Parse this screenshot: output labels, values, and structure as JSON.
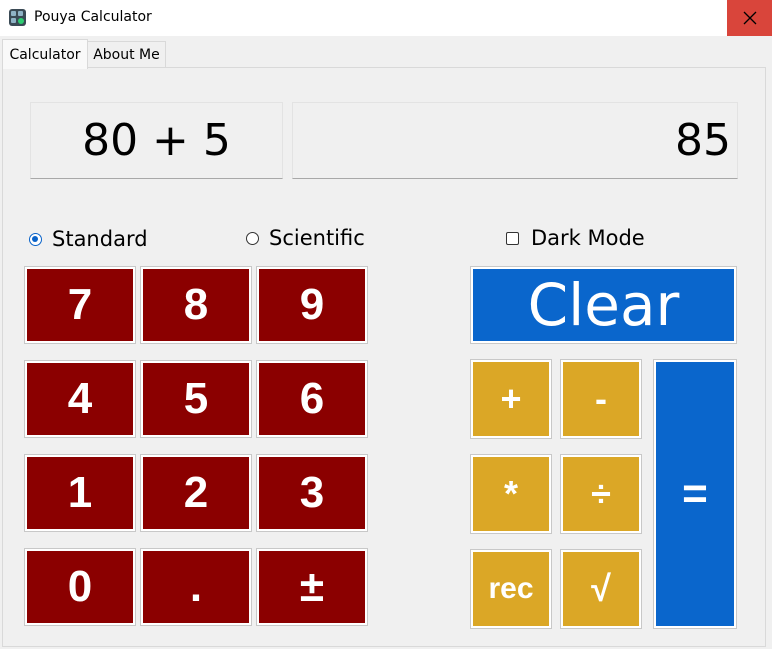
{
  "window": {
    "title": "Pouya Calculator",
    "close_icon": "close-icon"
  },
  "tabs": [
    {
      "label": "Calculator",
      "active": true
    },
    {
      "label": "About Me",
      "active": false
    }
  ],
  "display": {
    "expression": "80 + 5",
    "result": "85"
  },
  "modes": {
    "standard_label": "Standard",
    "scientific_label": "Scientific",
    "selected": "Standard",
    "dark_mode_label": "Dark Mode",
    "dark_mode_checked": false
  },
  "keypad": {
    "k7": "7",
    "k8": "8",
    "k9": "9",
    "k4": "4",
    "k5": "5",
    "k6": "6",
    "k1": "1",
    "k2": "2",
    "k3": "3",
    "k0": "0",
    "dot": ".",
    "sign": "±"
  },
  "operators": {
    "clear": "Clear",
    "plus": "+",
    "minus": "-",
    "multiply": "*",
    "divide": "÷",
    "reciprocal": "rec",
    "sqrt": "√",
    "equals": "="
  },
  "colors": {
    "number_key": "#8b0000",
    "operator_key": "#dba726",
    "accent_blue": "#0a66cc",
    "close_button": "#d9453b",
    "radio_selected": "#0a63c9"
  }
}
